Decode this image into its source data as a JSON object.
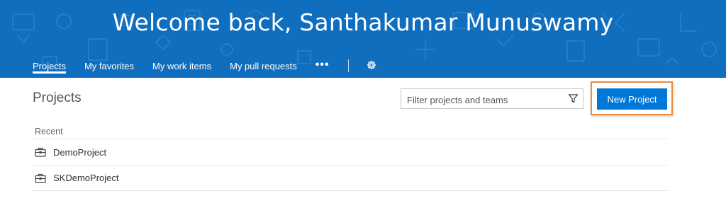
{
  "banner": {
    "welcome_text": "Welcome back, Santhakumar Munuswamy",
    "background_color": "#106ebe"
  },
  "hub_nav": {
    "tabs": [
      {
        "label": "Projects",
        "selected": true
      },
      {
        "label": "My favorites",
        "selected": false
      },
      {
        "label": "My work items",
        "selected": false
      },
      {
        "label": "My pull requests",
        "selected": false
      }
    ],
    "more_label": "•••",
    "settings_icon": "gear-icon"
  },
  "main": {
    "title": "Projects",
    "filter": {
      "placeholder": "Filter projects and teams",
      "value": "",
      "icon": "filter-icon"
    },
    "new_project_label": "New Project",
    "accent_color": "#0078d7",
    "highlight_color": "#ec8a3c",
    "recent": {
      "label": "Recent",
      "items": [
        {
          "name": "DemoProject",
          "icon": "briefcase-icon"
        },
        {
          "name": "SKDemoProject",
          "icon": "briefcase-icon"
        }
      ]
    }
  }
}
